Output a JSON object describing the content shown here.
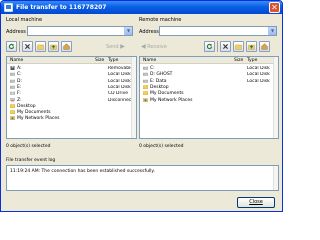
{
  "window": {
    "title": "File transfer to 116778207"
  },
  "local": {
    "heading": "Local machine",
    "address_label": "Address",
    "address_value": "",
    "send_label": "Send",
    "columns": {
      "name": "Name",
      "size": "Size",
      "type": "Type"
    },
    "rows": [
      {
        "name": "A:",
        "size": "",
        "type": "Removable D",
        "icon": "floppy-icon"
      },
      {
        "name": "C:",
        "size": "",
        "type": "Local Disk",
        "icon": "drive-icon"
      },
      {
        "name": "D:",
        "size": "",
        "type": "Local Disk",
        "icon": "drive-icon"
      },
      {
        "name": "E:",
        "size": "",
        "type": "Local Disk",
        "icon": "drive-icon"
      },
      {
        "name": "F:",
        "size": "",
        "type": "CD Drive",
        "icon": "cd-drive-icon"
      },
      {
        "name": "Z:",
        "size": "",
        "type": "Disconnecte",
        "icon": "network-drive-icon"
      },
      {
        "name": "Desktop",
        "size": "",
        "type": "",
        "icon": "folder-icon"
      },
      {
        "name": "My Documents",
        "size": "",
        "type": "",
        "icon": "folder-icon"
      },
      {
        "name": "My Network Places",
        "size": "",
        "type": "",
        "icon": "network-icon"
      }
    ],
    "status": "0 object(s) selected"
  },
  "remote": {
    "heading": "Remote machine",
    "address_label": "Address",
    "address_value": "",
    "receive_label": "Receive",
    "columns": {
      "name": "Name",
      "size": "Size",
      "type": "Type"
    },
    "rows": [
      {
        "name": "C:",
        "size": "",
        "type": "Local Disk",
        "icon": "drive-icon"
      },
      {
        "name": "D: GHOST",
        "size": "",
        "type": "Local Disk",
        "icon": "drive-icon"
      },
      {
        "name": "E: Data",
        "size": "",
        "type": "Local Disk",
        "icon": "drive-icon"
      },
      {
        "name": "Desktop",
        "size": "",
        "type": "",
        "icon": "folder-icon"
      },
      {
        "name": "My Documents",
        "size": "",
        "type": "",
        "icon": "folder-icon"
      },
      {
        "name": "My Network Places",
        "size": "",
        "type": "",
        "icon": "network-icon"
      }
    ],
    "status": "0 object(s) selected"
  },
  "log": {
    "label": "File transfer event log",
    "entries": [
      "11:19:24 AM: The connection has been established successfully."
    ]
  },
  "buttons": {
    "close_label": "Close"
  },
  "colors": {
    "titlebar": "#0a5fe6",
    "window_bg": "#ece9d8",
    "border": "#7f9db9",
    "close_x": "#e0522e",
    "folder": "#f2cf5c"
  }
}
